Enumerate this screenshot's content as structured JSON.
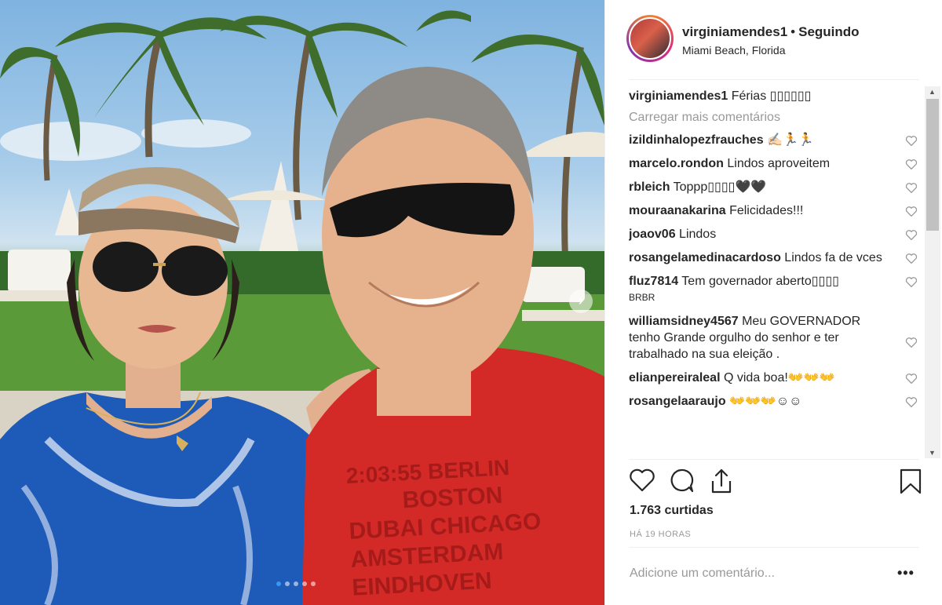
{
  "post": {
    "username": "virginiamendes1",
    "separator": "•",
    "follow_status": "Seguindo",
    "location": "Miami Beach, Florida",
    "caption_text": "Férias ▯▯▯▯▯▯",
    "load_more": "Carregar mais comentários",
    "likes": "1.763 curtidas",
    "time_ago": "HÁ 19 HORAS",
    "add_comment_placeholder": "Adicione um comentário...",
    "more_label": "•••"
  },
  "comments": [
    {
      "user": "izildinhalopezfrauches",
      "text": "✍🏻🏃🏃"
    },
    {
      "user": "marcelo.rondon",
      "text": "Lindos aproveitem"
    },
    {
      "user": "rbleich",
      "text": "Toppp▯▯▯▯🖤🖤"
    },
    {
      "user": "mouraanakarina",
      "text": "Felicidades!!!"
    },
    {
      "user": "joaov06",
      "text": "Lindos"
    },
    {
      "user": "rosangelamedinacardoso",
      "text": "Lindos fa de vces"
    },
    {
      "user": "fluz7814",
      "text": "Tem governador aberto▯▯▯▯",
      "extra": "BRBR"
    },
    {
      "user": "williamsidney4567",
      "text": "Meu GOVERNADOR tenho Grande orgulho do senhor e ter trabalhado na sua eleição ."
    },
    {
      "user": "elianpereiraleal",
      "text": "Q vida boa!👐👐👐"
    },
    {
      "user": "rosangelaaraujo",
      "text": "👐👐👐☺☺"
    }
  ],
  "shirt_text": {
    "line1": "2:03:55 BERLIN",
    "line2": "BOSTON",
    "line3": "DUBAI CHICAGO",
    "line4": "AMSTERDAM",
    "line5": "EINDHOVEN"
  },
  "icons": {
    "like": "heart-icon",
    "comment": "comment-bubble-icon",
    "share": "share-icon",
    "save": "bookmark-icon"
  },
  "colors": {
    "link_blue": "#3897f0",
    "text": "#262626",
    "muted": "#999999",
    "shirt_red": "#d42a27",
    "dress_blue": "#1e5bb8"
  }
}
